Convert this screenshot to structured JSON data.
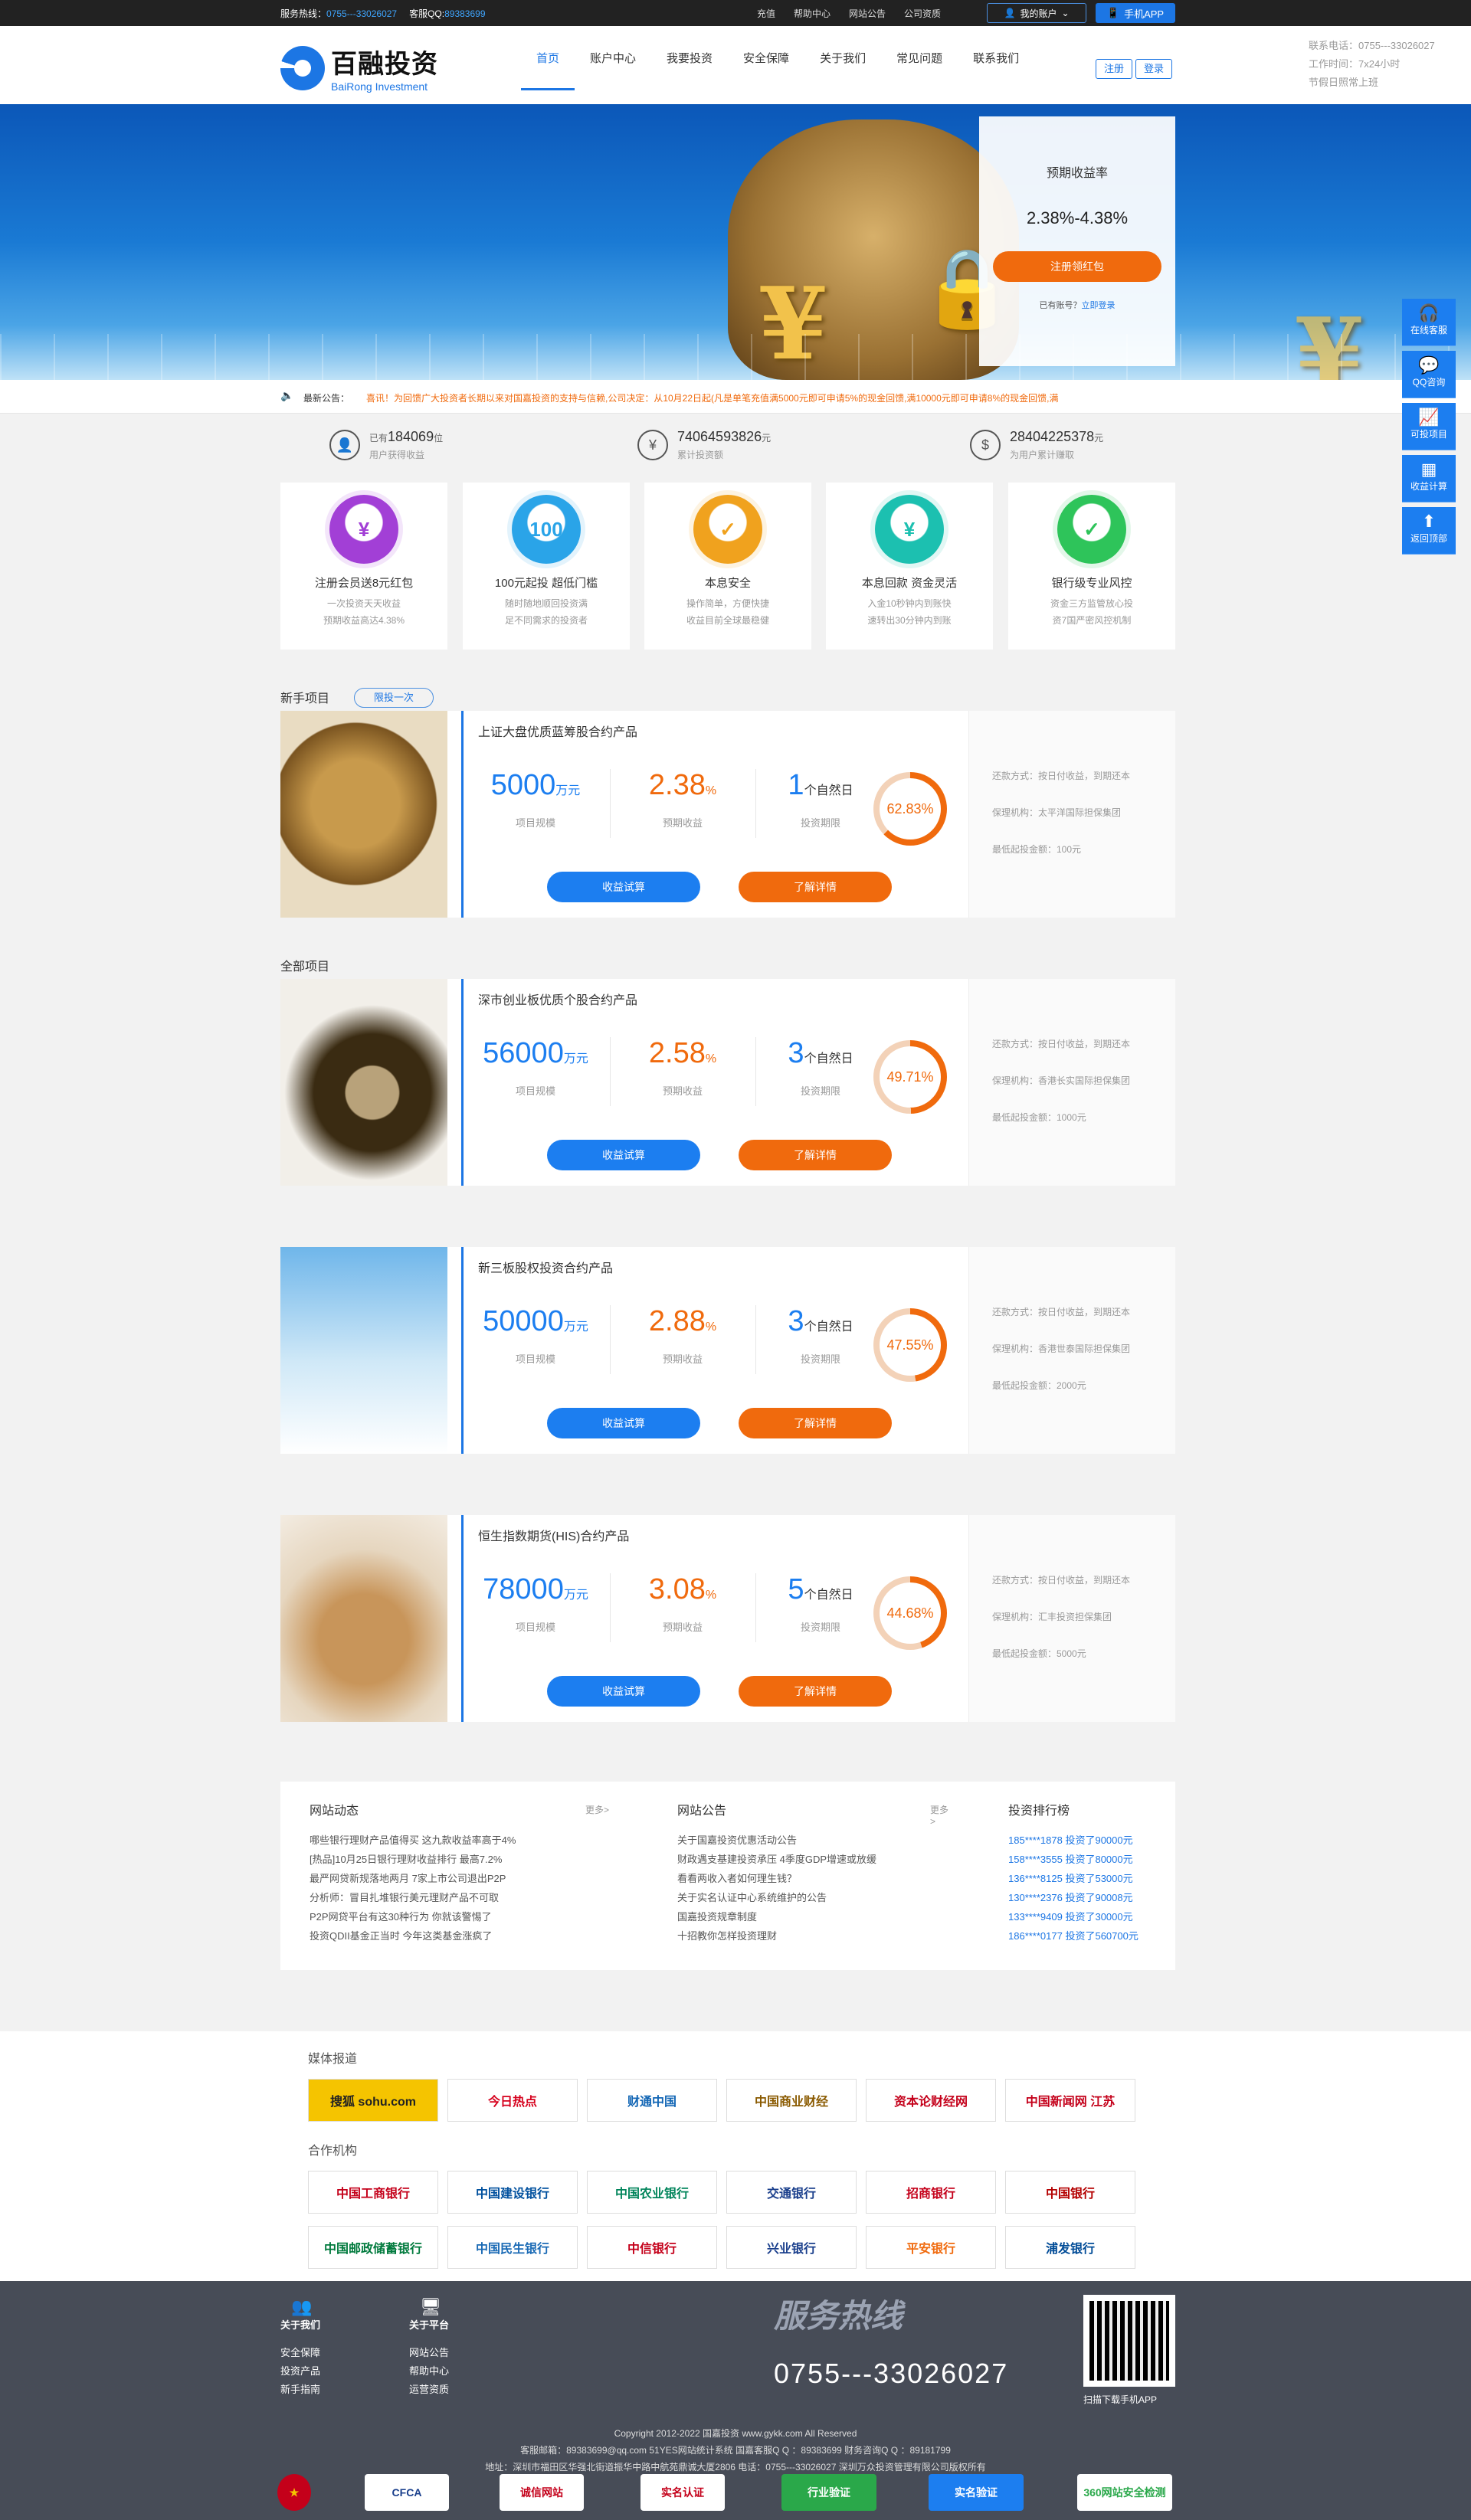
{
  "topbar": {
    "hotline_label": "服务热线：",
    "hotline": "0755---33026027",
    "qq_label": "客服QQ:",
    "qq": "89383699",
    "links": [
      "充值",
      "帮助中心",
      "网站公告",
      "公司资质"
    ],
    "account": "我的账户",
    "app": "手机APP"
  },
  "header": {
    "logo_cn": "百融投资",
    "logo_en": "BaiRong Investment",
    "nav": [
      "首页",
      "账户中心",
      "我要投资",
      "安全保障",
      "关于我们",
      "常见问题",
      "联系我们"
    ],
    "register": "注册",
    "login": "登录",
    "contact": [
      "联系电话：0755---33026027",
      "工作时间：7x24小时",
      "节假日照常上班"
    ]
  },
  "banner": {
    "rate_label": "预期收益率",
    "rate": "2.38%-4.38%",
    "btn": "注册领红包",
    "have_account": "已有账号？",
    "login_now": "立即登录"
  },
  "notice": {
    "label": "最新公告：",
    "text": "喜讯！为回馈广大投资者长期以来对国嘉投资的支持与信赖,公司决定：从10月22日起(凡是单笔充值满5000元即可申请5%的现金回馈,满10000元即可申请8%的现金回馈,满"
  },
  "stats": [
    {
      "icon": "user-icon",
      "pre": "已有",
      "num": "184069",
      "unit": "位",
      "sub": "用户获得收益"
    },
    {
      "icon": "yen-icon",
      "pre": "",
      "num": "74064593826",
      "unit": "元",
      "sub": "累计投资额"
    },
    {
      "icon": "dollar-icon",
      "pre": "",
      "num": "28404225378",
      "unit": "元",
      "sub": "为用户累计赚取"
    }
  ],
  "features": [
    {
      "title": "注册会员送8元红包",
      "d1": "一次投资天天收益",
      "d2": "预期收益高达4.38%",
      "color": "#a23fd6",
      "glyph": "¥"
    },
    {
      "title": "100元起投 超低门槛",
      "d1": "随时随地顺回投资满",
      "d2": "足不同需求的投资者",
      "color": "#2aa4e8",
      "glyph": "100"
    },
    {
      "title": "本息安全",
      "d1": "操作简单，方便快捷",
      "d2": "收益目前全球最稳健",
      "color": "#f0a21e",
      "glyph": "✓"
    },
    {
      "title": "本息回款 资金灵活",
      "d1": "入金10秒钟内到账快",
      "d2": "速转出30分钟内到账",
      "color": "#1cc0b0",
      "glyph": "¥"
    },
    {
      "title": "银行级专业风控",
      "d1": "资金三方监管放心投",
      "d2": "资7国严密风控机制",
      "color": "#2ec45a",
      "glyph": "✓"
    }
  ],
  "sections": {
    "newbie": "新手项目",
    "newbie_tag": "限投一次",
    "all": "全部项目"
  },
  "products": [
    {
      "name": "上证大盘优质蓝筹股合约产品",
      "scale": "5000",
      "scale_unit": "万元",
      "rate": "2.38",
      "term": "1",
      "term_unit": "个自然日",
      "progress": 62.83,
      "progress_text": "62.83%",
      "repay": "还款方式：按日付收益，到期还本",
      "guarantor": "保理机构：太平洋国际担保集团",
      "min": "最低起投金额：100元"
    },
    {
      "name": "深市创业板优质个股合约产品",
      "scale": "56000",
      "scale_unit": "万元",
      "rate": "2.58",
      "term": "3",
      "term_unit": "个自然日",
      "progress": 49.71,
      "progress_text": "49.71%",
      "repay": "还款方式：按日付收益，到期还本",
      "guarantor": "保理机构：香港长实国际担保集团",
      "min": "最低起投金额：1000元"
    },
    {
      "name": "新三板股权投资合约产品",
      "scale": "50000",
      "scale_unit": "万元",
      "rate": "2.88",
      "term": "3",
      "term_unit": "个自然日",
      "progress": 47.55,
      "progress_text": "47.55%",
      "repay": "还款方式：按日付收益，到期还本",
      "guarantor": "保理机构：香港世泰国际担保集团",
      "min": "最低起投金额：2000元"
    },
    {
      "name": "恒生指数期货(HIS)合约产品",
      "scale": "78000",
      "scale_unit": "万元",
      "rate": "3.08",
      "term": "5",
      "term_unit": "个自然日",
      "progress": 44.68,
      "progress_text": "44.68%",
      "repay": "还款方式：按日付收益，到期还本",
      "guarantor": "保理机构：汇丰投资担保集团",
      "min": "最低起投金额：5000元"
    }
  ],
  "labels": {
    "scale": "项目规模",
    "rate": "预期收益",
    "term": "投资期限",
    "pct": "%",
    "calc": "收益试算",
    "detail": "了解详情"
  },
  "news": {
    "dyn_title": "网站动态",
    "more": "更多>",
    "dyn": [
      "哪些银行理财产品值得买 这九款收益率高于4%",
      "[热品]10月25日银行理财收益排行 最高7.2%",
      "最严网贷新规落地两月 7家上市公司退出P2P",
      "分析师：冒目扎堆银行美元理财产品不可取",
      "P2P网贷平台有这30种行为 你就该警惕了",
      "投资QDII基金正当时 今年这类基金涨疯了"
    ],
    "ann_title": "网站公告",
    "ann": [
      "关于国嘉投资优惠活动公告",
      "财政遇支基建投资承压 4季度GDP增速或放缓",
      "看看两收入者如何理生钱？",
      "关于实名认证中心系统维护的公告",
      "国嘉投资规章制度",
      "十招教你怎样投资理财"
    ],
    "rank_title": "投资排行榜",
    "rank": [
      "185****1878 投资了90000元",
      "158****3555 投资了80000元",
      "136****8125 投资了53000元",
      "130****2376 投资了90008元",
      "133****9409 投资了30000元",
      "186****0177 投资了560700元"
    ]
  },
  "partners": {
    "media_title": "媒体报道",
    "media": [
      "搜狐 sohu.com",
      "今日热点",
      "财通中国",
      "中国商业财经",
      "资本论财经网",
      "中国新闻网 江苏"
    ],
    "org_title": "合作机构",
    "banks": [
      "中国工商银行",
      "中国建设银行",
      "中国农业银行",
      "交通银行",
      "招商银行",
      "中国银行",
      "中国邮政储蓄银行",
      "中国民生银行",
      "中信银行",
      "兴业银行",
      "平安银行",
      "浦发银行"
    ]
  },
  "footer": {
    "about": "关于我们",
    "about_items": [
      "安全保障",
      "投资产品",
      "新手指南"
    ],
    "platform": "关于平台",
    "platform_items": [
      "网站公告",
      "帮助中心",
      "运营资质"
    ],
    "hotline_title": "服务热线",
    "phone": "0755---33026027",
    "qr_text": "扫描下载手机APP",
    "copy1": "Copyright 2012-2022  国嘉投资 www.gykk.com All Reserved",
    "copy2": "客服邮箱：89383699@qq.com 51YES网站统计系统  国嘉客服Q Q ：89383699  财务咨询Q Q ：89181799",
    "copy3": "地址：深圳市福田区华强北街道振华中路中航苑鼎诚大厦2806  电话：0755---33026027 深圳万众投资管理有限公司版权所有",
    "badges": [
      "",
      "CFCA",
      "诚信网站",
      "实名认证",
      "行业验证",
      "实名验证",
      "360网站安全检测"
    ]
  },
  "side": [
    "在线客服",
    "QQ咨询",
    "可投项目",
    "收益计算",
    "返回顶部"
  ]
}
